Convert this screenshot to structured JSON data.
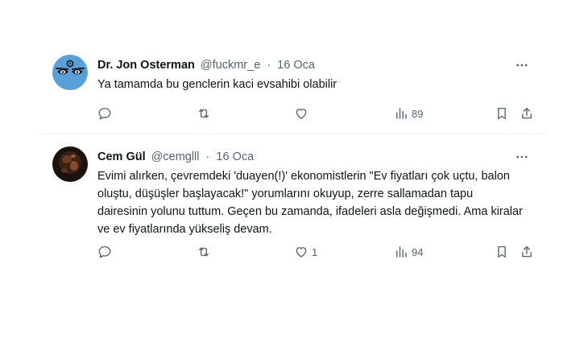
{
  "tweets": [
    {
      "author_name": "Dr. Jon Osterman",
      "handle": "@fuckmr_e",
      "separator": "·",
      "date": "16 Oca",
      "text": "Ya tamamda bu genclerin kaci evsahibi olabilir",
      "actions": {
        "replies": "",
        "retweets": "",
        "likes": "",
        "views": "89"
      },
      "avatar_icon": "manhattan-symbol-eyes-avatar"
    },
    {
      "author_name": "Cem Gül",
      "handle": "@cemglll",
      "separator": "·",
      "date": "16 Oca",
      "text": "Evimi alırken, çevremdeki 'duayen(!)' ekonomistlerin \"Ev fiyatları çok uçtu, balon oluştu, düşüşler başlayacak!\" yorumlarını okuyup, zerre sallamadan tapu dairesinin yolunu tuttum. Geçen bu zamanda, ifadeleri asla değişmedi. Ama kiralar ve ev fiyatlarında yükseliş devam.",
      "actions": {
        "replies": "",
        "retweets": "",
        "likes": "1",
        "views": "94"
      },
      "avatar_icon": "dark-photo-avatar"
    }
  ],
  "colors": {
    "text": "#0f1419",
    "secondary": "#536471",
    "divider": "#eff3f4",
    "avatar1_bg": "#5aa0d8"
  }
}
